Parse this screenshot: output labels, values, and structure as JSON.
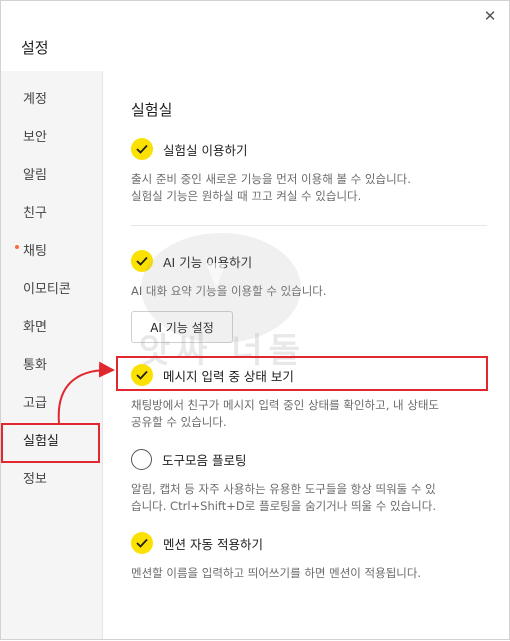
{
  "window": {
    "title": "설정",
    "close_icon": "close-icon",
    "close_glyph": "✕"
  },
  "sidebar": {
    "items": [
      {
        "label": "계정"
      },
      {
        "label": "보안"
      },
      {
        "label": "알림"
      },
      {
        "label": "친구"
      },
      {
        "label": "채팅",
        "new_dot": true
      },
      {
        "label": "이모티콘"
      },
      {
        "label": "화면"
      },
      {
        "label": "통화"
      },
      {
        "label": "고급"
      },
      {
        "label": "실험실",
        "active": true
      },
      {
        "label": "정보"
      }
    ]
  },
  "main": {
    "section_title": "실험실",
    "options": [
      {
        "label": "실험실 이용하기",
        "checked": true,
        "desc": "출시 준비 중인 새로운 기능을 먼저 이용해 볼 수 있습니다.",
        "desc2": "실험실 기능은 원하실 때 끄고 켜실 수 있습니다."
      },
      {
        "label": "AI 기능 이용하기",
        "checked": true,
        "desc": "AI 대화 요약 기능을 이용할 수 있습니다.",
        "button": "AI 기능 설정"
      },
      {
        "label": "메시지 입력 중 상태 보기",
        "checked": true,
        "desc": "채팅방에서 친구가 메시지 입력 중인 상태를 확인하고, 내 상태도",
        "desc2": "공유할 수 있습니다."
      },
      {
        "label": "도구모음 플로팅",
        "checked": false,
        "desc": "알림, 캡처 등 자주 사용하는 유용한 도구들을 항상 띄워둘 수 있",
        "desc2": "습니다. Ctrl+Shift+D로 플로팅을 숨기거나 띄울 수 있습니다."
      },
      {
        "label": "멘션 자동 적용하기",
        "checked": true,
        "desc": "멘션할 이름을 입력하고 띄어쓰기를 하면 멘션이 적용됩니다."
      }
    ]
  },
  "watermark": {
    "text": "앗싸 너돌"
  },
  "annotation_color": "#e0282e",
  "accent_color": "#fae100"
}
